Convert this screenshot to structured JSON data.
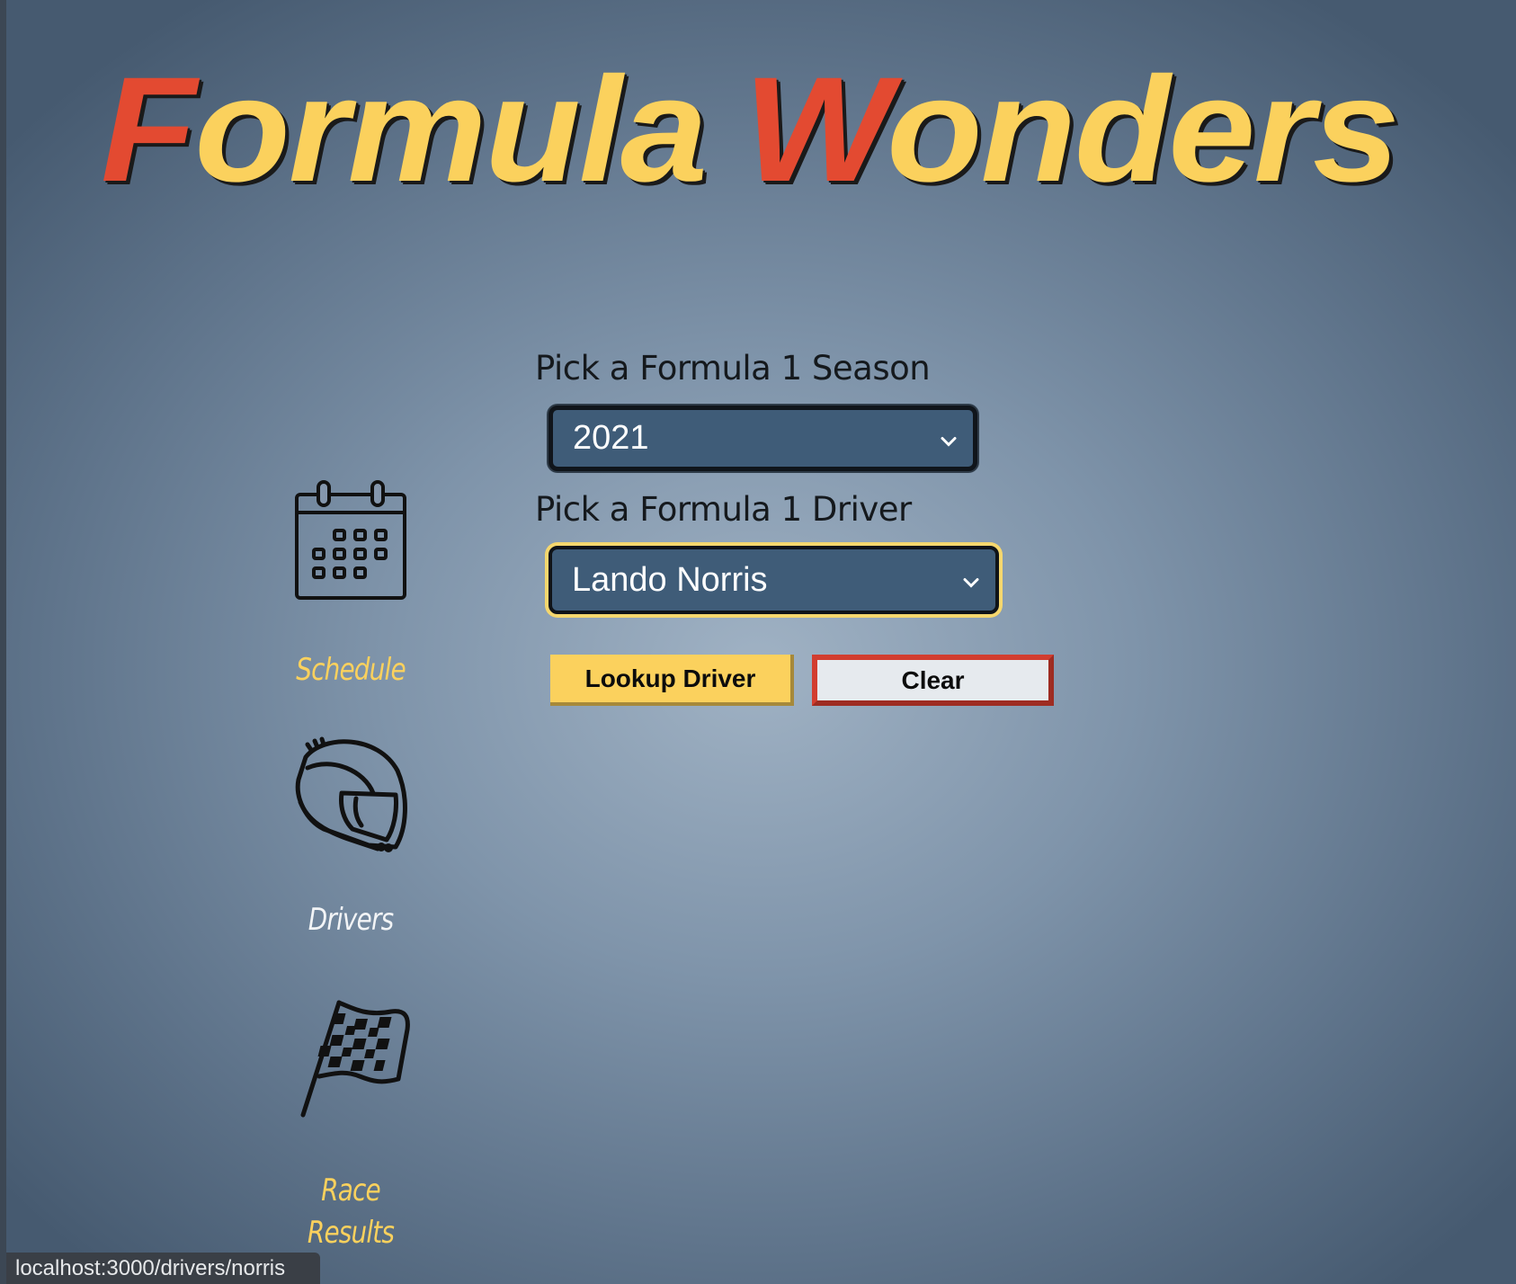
{
  "app": {
    "title_part1_initial": "F",
    "title_part1_rest": "ormula",
    "title_part2_initial": "W",
    "title_part2_rest": "onders"
  },
  "nav": {
    "items": [
      {
        "label": "Schedule",
        "icon": "calendar-icon",
        "color": "#fbd15d"
      },
      {
        "label": "Drivers",
        "icon": "helmet-icon",
        "color": "#f2f4f6"
      },
      {
        "label_line1": "Race",
        "label_line2": "Results",
        "icon": "checkered-flag-icon",
        "color": "#fbd15d"
      }
    ]
  },
  "form": {
    "season_label": "Pick a Formula 1 Season",
    "season_value": "2021",
    "driver_label": "Pick a Formula 1 Driver",
    "driver_value": "Lando Norris",
    "lookup_button": "Lookup Driver",
    "clear_button": "Clear"
  },
  "status_bar": {
    "url": "localhost:3000/drivers/norris"
  },
  "colors": {
    "accent_yellow": "#fbd15d",
    "accent_red": "#e34a31",
    "select_bg": "#3f5c78",
    "background": "#7f94aa"
  }
}
